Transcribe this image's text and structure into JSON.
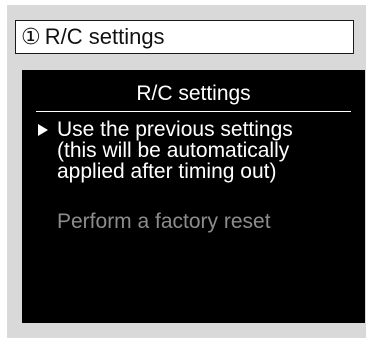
{
  "caption": {
    "number": "①",
    "title": "R/C settings"
  },
  "screen": {
    "title": "R/C settings",
    "menu": [
      {
        "label": "Use the previous settings\n(this will be automatically\napplied after timing out)",
        "selected": true,
        "enabled": true,
        "cursor_icon": "triangle-right-icon"
      },
      {
        "label": "Perform a factory reset",
        "selected": false,
        "enabled": false
      }
    ]
  },
  "colors": {
    "screen_background": "#000000",
    "screen_text": "#ffffff",
    "disabled_text": "#8c8c8c",
    "frame_background": "#d9d9d9"
  }
}
